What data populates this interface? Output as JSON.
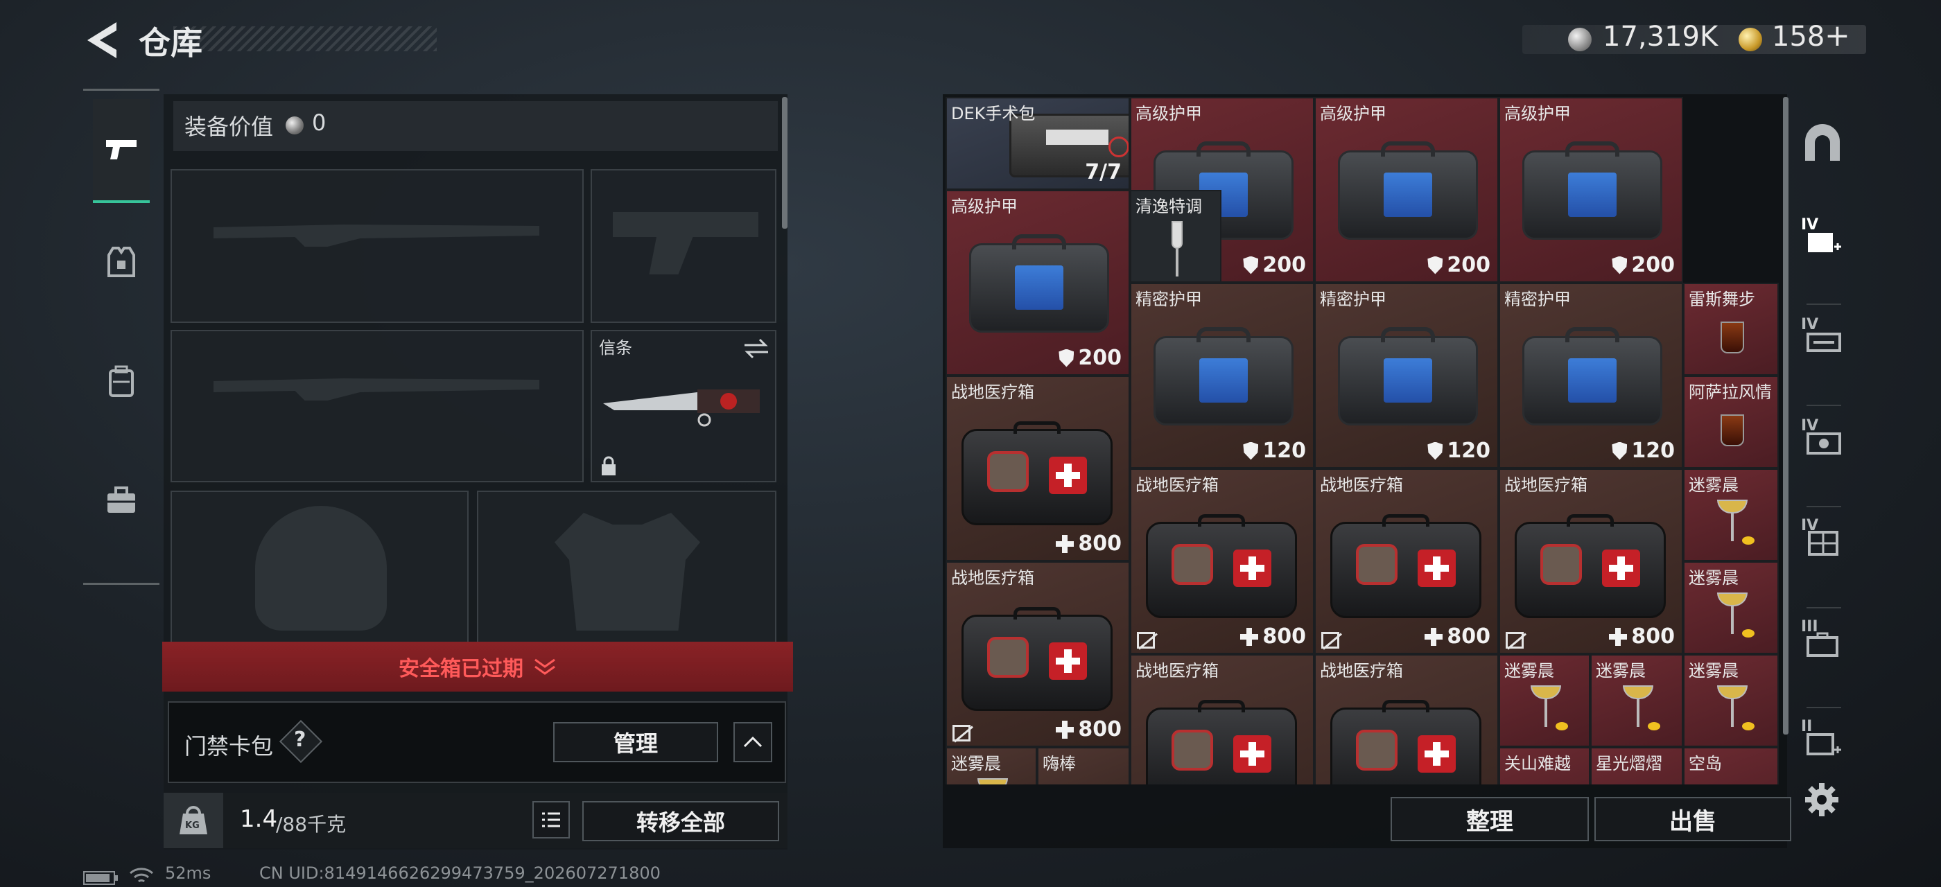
{
  "header": {
    "title": "仓库",
    "silver_amount": "17,319K",
    "gold_amount": "158",
    "add_label": "+"
  },
  "equipment": {
    "value_label": "装备价值",
    "value": "0",
    "slot_melee_label": "信条",
    "safebox_warning": "安全箱已过期",
    "keycard_label": "门禁卡包",
    "help_label": "?",
    "manage_label": "管理",
    "weight_current": "1.4",
    "weight_max": "/88千克",
    "weight_icon_text": "KG",
    "transfer_all_label": "转移全部"
  },
  "inventory": {
    "items": [
      {
        "name": "DEK手术包",
        "value": "7/7",
        "kind": "surgery",
        "color": "blue"
      },
      {
        "name": "高级护甲",
        "value": "200",
        "kind": "armor",
        "color": "red"
      },
      {
        "name": "高级护甲",
        "value": "200",
        "kind": "armor",
        "color": "red"
      },
      {
        "name": "高级护甲",
        "value": "200",
        "kind": "armor",
        "color": "red"
      },
      {
        "name": "高级护甲",
        "value": "200",
        "kind": "armor",
        "color": "red"
      },
      {
        "name": "清逸特调",
        "value": "",
        "kind": "glass",
        "color": "dark"
      },
      {
        "name": "精密护甲",
        "value": "120",
        "kind": "armor",
        "color": "brown"
      },
      {
        "name": "精密护甲",
        "value": "120",
        "kind": "armor",
        "color": "brown"
      },
      {
        "name": "精密护甲",
        "value": "120",
        "kind": "armor",
        "color": "brown"
      },
      {
        "name": "雷斯舞步",
        "value": "",
        "kind": "drink",
        "color": "red"
      },
      {
        "name": "阿萨拉风情",
        "value": "",
        "kind": "drink",
        "color": "red"
      },
      {
        "name": "战地医疗箱",
        "value": "800",
        "kind": "med",
        "color": "brown"
      },
      {
        "name": "战地医疗箱",
        "value": "800",
        "kind": "med",
        "color": "brown"
      },
      {
        "name": "战地医疗箱",
        "value": "800",
        "kind": "med",
        "color": "brown"
      },
      {
        "name": "战地医疗箱",
        "value": "800",
        "kind": "med",
        "color": "brown"
      },
      {
        "name": "迷雾晨",
        "value": "",
        "kind": "cocktail",
        "color": "red"
      },
      {
        "name": "战地医疗箱",
        "value": "800",
        "kind": "med",
        "color": "brown"
      },
      {
        "name": "迷雾晨",
        "value": "",
        "kind": "cocktail",
        "color": "red"
      },
      {
        "name": "战地医疗箱",
        "value": "",
        "kind": "med",
        "color": "brown"
      },
      {
        "name": "战地医疗箱",
        "value": "",
        "kind": "med",
        "color": "brown"
      },
      {
        "name": "迷雾晨",
        "value": "",
        "kind": "cocktail",
        "color": "red"
      },
      {
        "name": "迷雾晨",
        "value": "",
        "kind": "cocktail",
        "color": "red"
      },
      {
        "name": "迷雾晨",
        "value": "",
        "kind": "cocktail",
        "color": "red"
      },
      {
        "name": "迷雾晨",
        "value": "",
        "kind": "cocktail",
        "color": "brown"
      },
      {
        "name": "嗨棒",
        "value": "",
        "kind": "drink",
        "color": "brown"
      },
      {
        "name": "关山难越",
        "value": "",
        "kind": "drink",
        "color": "red"
      },
      {
        "name": "星光熠熠",
        "value": "",
        "kind": "drink",
        "color": "red"
      },
      {
        "name": "空岛",
        "value": "",
        "kind": "drink",
        "color": "red"
      }
    ],
    "sort_label": "整理",
    "sell_label": "出售"
  },
  "right_nav": [
    "IV",
    "IV",
    "IV",
    "IV",
    "III",
    "II"
  ],
  "status": {
    "ping": "52ms",
    "uid": "CN UID:8149146626299473759_202607271800"
  }
}
